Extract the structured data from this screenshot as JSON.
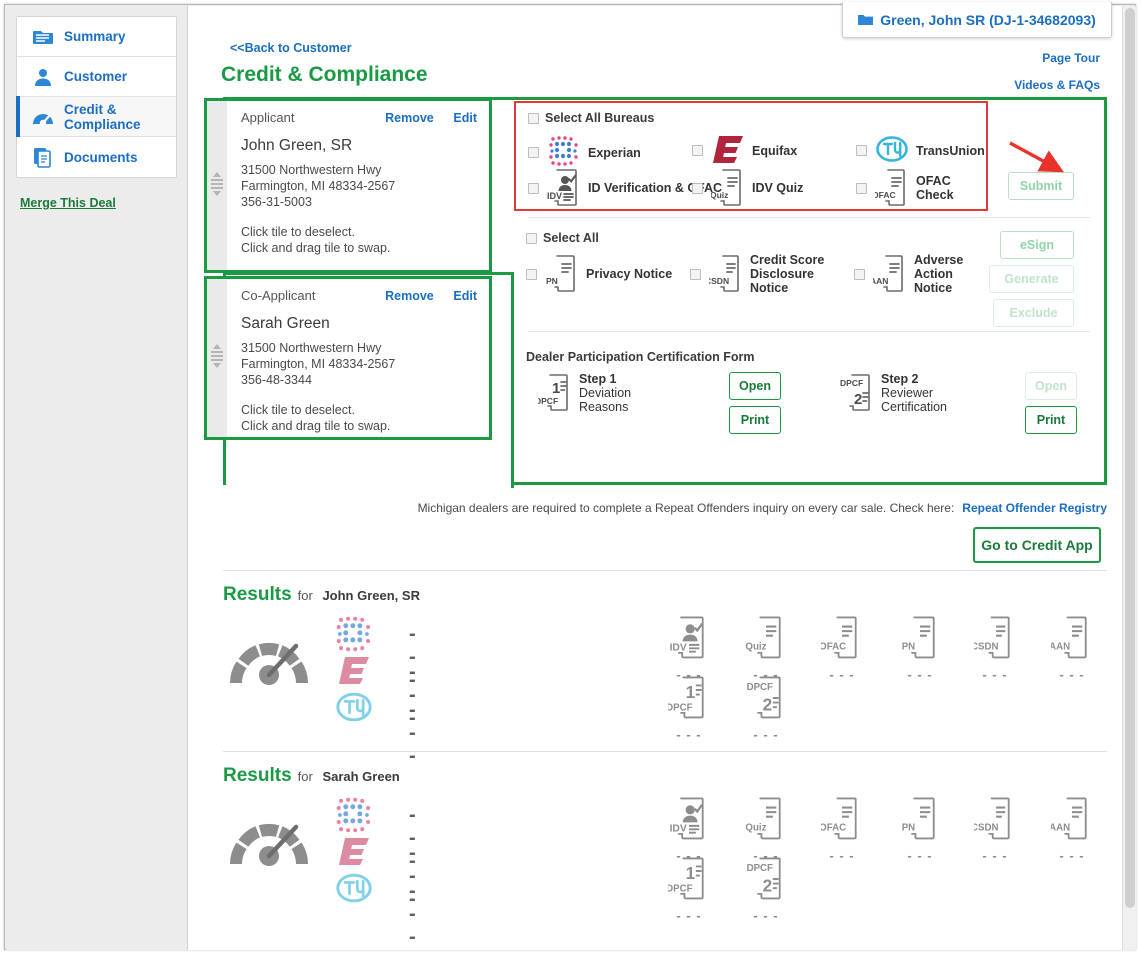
{
  "sidebar": {
    "items": [
      {
        "label": "Summary",
        "icon": "summary-folder-icon",
        "active": false
      },
      {
        "label": "Customer",
        "icon": "person-icon",
        "active": false
      },
      {
        "label": "Credit & Compliance",
        "icon": "gauge-icon",
        "active": true
      },
      {
        "label": "Documents",
        "icon": "documents-icon",
        "active": false
      }
    ],
    "merge_link": "Merge This Deal"
  },
  "header": {
    "customer_tab": "Green, John SR (DJ-1-34682093)",
    "back_link": "<<Back to Customer",
    "page_title": "Credit & Compliance",
    "page_tour": "Page Tour",
    "videos_faqs": "Videos & FAQs"
  },
  "tiles": [
    {
      "role": "Applicant",
      "remove": "Remove",
      "edit": "Edit",
      "name": "John Green, SR",
      "address1": "31500 Northwestern Hwy",
      "address2": "Farmington, MI 48334-2567",
      "ssn": "356-31-5003",
      "hint1": "Click tile to deselect.",
      "hint2": "Click and drag tile to swap."
    },
    {
      "role": "Co-Applicant",
      "remove": "Remove",
      "edit": "Edit",
      "name": "Sarah Green",
      "address1": "31500 Northwestern Hwy",
      "address2": "Farmington, MI 48334-2567",
      "ssn": "356-48-3344",
      "hint1": "Click tile to deselect.",
      "hint2": "Click and drag tile to swap."
    }
  ],
  "bureaus": {
    "select_all_label": "Select All Bureaus",
    "highlight_color": "#e53935",
    "items": [
      {
        "label": "Experian",
        "icon": "experian-logo",
        "checked": false
      },
      {
        "label": "Equifax",
        "icon": "equifax-logo",
        "checked": false
      },
      {
        "label": "TransUnion",
        "icon": "transunion-logo",
        "checked": false
      },
      {
        "label": "ID Verification & OFAC",
        "icon": "idv-document-icon",
        "tag": "IDV",
        "checked": false
      },
      {
        "label": "IDV Quiz",
        "icon": "quiz-document-icon",
        "tag": "Quiz",
        "checked": false
      },
      {
        "label": "OFAC Check",
        "icon": "ofac-document-icon",
        "tag": "OFAC",
        "checked": false
      }
    ],
    "submit_label": "Submit"
  },
  "documents": {
    "select_all_label": "Select All",
    "items": [
      {
        "label": "Privacy Notice",
        "tag": "PN",
        "icon": "pn-document-icon",
        "checked": false
      },
      {
        "label": "Credit Score Disclosure Notice",
        "tag": "CSDN",
        "icon": "csdn-document-icon",
        "checked": false
      },
      {
        "label": "Adverse Action Notice",
        "tag": "AAN",
        "icon": "aan-document-icon",
        "checked": false
      }
    ],
    "buttons": [
      {
        "label": "eSign",
        "state": "disabled"
      },
      {
        "label": "Generate",
        "state": "disabled"
      },
      {
        "label": "Exclude",
        "state": "disabled"
      }
    ]
  },
  "dpcf": {
    "title": "Dealer Participation Certification Form",
    "steps": [
      {
        "tag": "DPCF",
        "number": "1",
        "title": "Step 1",
        "line1": "Deviation",
        "line2": "Reasons",
        "open_label": "Open",
        "open_state": "enabled",
        "print_label": "Print",
        "print_state": "enabled"
      },
      {
        "tag": "DPCF",
        "number": "2",
        "title": "Step 2",
        "line1": "Reviewer",
        "line2": "Certification",
        "open_label": "Open",
        "open_state": "disabled",
        "print_label": "Print",
        "print_state": "enabled"
      }
    ]
  },
  "footer": {
    "note": "Michigan dealers are required to complete a Repeat Offenders inquiry on every car sale. Check here:",
    "registry_link": "Repeat Offender Registry",
    "credit_app_button": "Go to Credit App"
  },
  "results": [
    {
      "heading": "Results",
      "for_label": "for",
      "subject": "John Green, SR",
      "gauge": "empty-gauge-icon",
      "bureau_scores": [
        {
          "bureau": "experian-logo",
          "value": "- - -"
        },
        {
          "bureau": "equifax-logo",
          "value": "- - -"
        },
        {
          "bureau": "transunion-logo",
          "value": "- - -"
        }
      ],
      "docs_row1": [
        {
          "tag": "IDV",
          "icon": "idv-document-icon",
          "value": "- - -"
        },
        {
          "tag": "Quiz",
          "icon": "quiz-document-icon",
          "value": "- - -"
        },
        {
          "tag": "OFAC",
          "icon": "ofac-document-icon",
          "value": "- - -"
        },
        {
          "tag": "PN",
          "icon": "pn-document-icon",
          "value": "- - -"
        },
        {
          "tag": "CSDN",
          "icon": "csdn-document-icon",
          "value": "- - -"
        },
        {
          "tag": "AAN",
          "icon": "aan-document-icon",
          "value": "- - -"
        }
      ],
      "docs_row2": [
        {
          "tag": "DPCF",
          "number": "1",
          "icon": "dpcf1-document-icon",
          "value": "- - -"
        },
        {
          "tag": "DPCF",
          "number": "2",
          "icon": "dpcf2-document-icon",
          "value": "- - -"
        }
      ]
    },
    {
      "heading": "Results",
      "for_label": "for",
      "subject": "Sarah Green",
      "gauge": "empty-gauge-icon",
      "bureau_scores": [
        {
          "bureau": "experian-logo",
          "value": "- - -"
        },
        {
          "bureau": "equifax-logo",
          "value": "- - -"
        },
        {
          "bureau": "transunion-logo",
          "value": "- - -"
        }
      ],
      "docs_row1": [
        {
          "tag": "IDV",
          "icon": "idv-document-icon",
          "value": "- - -"
        },
        {
          "tag": "Quiz",
          "icon": "quiz-document-icon",
          "value": "- - -"
        },
        {
          "tag": "OFAC",
          "icon": "ofac-document-icon",
          "value": "- - -"
        },
        {
          "tag": "PN",
          "icon": "pn-document-icon",
          "value": "- - -"
        },
        {
          "tag": "CSDN",
          "icon": "csdn-document-icon",
          "value": "- - -"
        },
        {
          "tag": "AAN",
          "icon": "aan-document-icon",
          "value": "- - -"
        }
      ],
      "docs_row2": [
        {
          "tag": "DPCF",
          "number": "1",
          "icon": "dpcf1-document-icon",
          "value": "- - -"
        },
        {
          "tag": "DPCF",
          "number": "2",
          "icon": "dpcf2-document-icon",
          "value": "- - -"
        }
      ]
    }
  ],
  "colors": {
    "green": "#1a9a42",
    "blue": "#1b6ec2",
    "red_highlight": "#e53935",
    "experian_blue": "#3b7fd4",
    "experian_pink": "#e8467c",
    "equifax_red": "#b0243c",
    "transunion_cyan": "#33b5dd"
  }
}
